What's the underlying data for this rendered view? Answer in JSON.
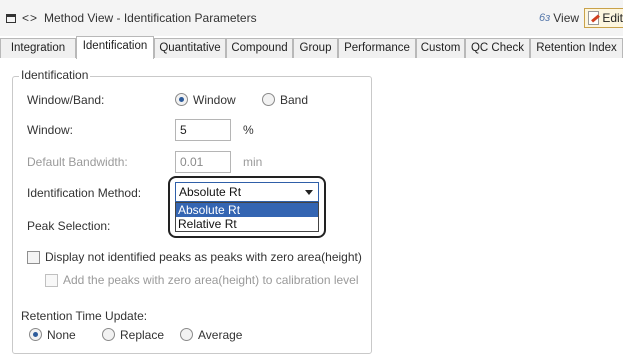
{
  "window": {
    "nav_glyph": "<>",
    "title": "Method View - Identification Parameters",
    "view_label": "View",
    "edit_label": "Edit"
  },
  "tabs": [
    {
      "label": "Integration"
    },
    {
      "label": "Identification"
    },
    {
      "label": "Quantitative"
    },
    {
      "label": "Compound"
    },
    {
      "label": "Group"
    },
    {
      "label": "Performance"
    },
    {
      "label": "Custom"
    },
    {
      "label": "QC Check"
    },
    {
      "label": "Retention Index"
    }
  ],
  "identification": {
    "legend": "Identification",
    "window_band": {
      "label": "Window/Band:",
      "options": [
        "Window",
        "Band"
      ],
      "selected": "Window"
    },
    "window": {
      "label": "Window:",
      "value": "5",
      "unit": "%"
    },
    "default_bandwidth": {
      "label": "Default Bandwidth:",
      "value": "0.01",
      "unit": "min"
    },
    "method": {
      "label": "Identification Method:",
      "value": "Absolute Rt",
      "options": [
        "Absolute Rt",
        "Relative Rt"
      ],
      "highlighted": "Absolute Rt"
    },
    "peak_selection": {
      "label": "Peak Selection:"
    },
    "display_not_identified": {
      "label": "Display not identified peaks as peaks with zero area(height)",
      "checked": false
    },
    "add_zero_peaks": {
      "label": "Add the peaks with zero area(height) to calibration level",
      "checked": false
    }
  },
  "retention": {
    "label": "Retention Time Update:",
    "options": [
      "None",
      "Replace",
      "Average"
    ],
    "selected": "None"
  },
  "colors": {
    "accent": "#3465b2",
    "highlight_border": "#222222",
    "edit_button_border": "#c9a24a"
  }
}
